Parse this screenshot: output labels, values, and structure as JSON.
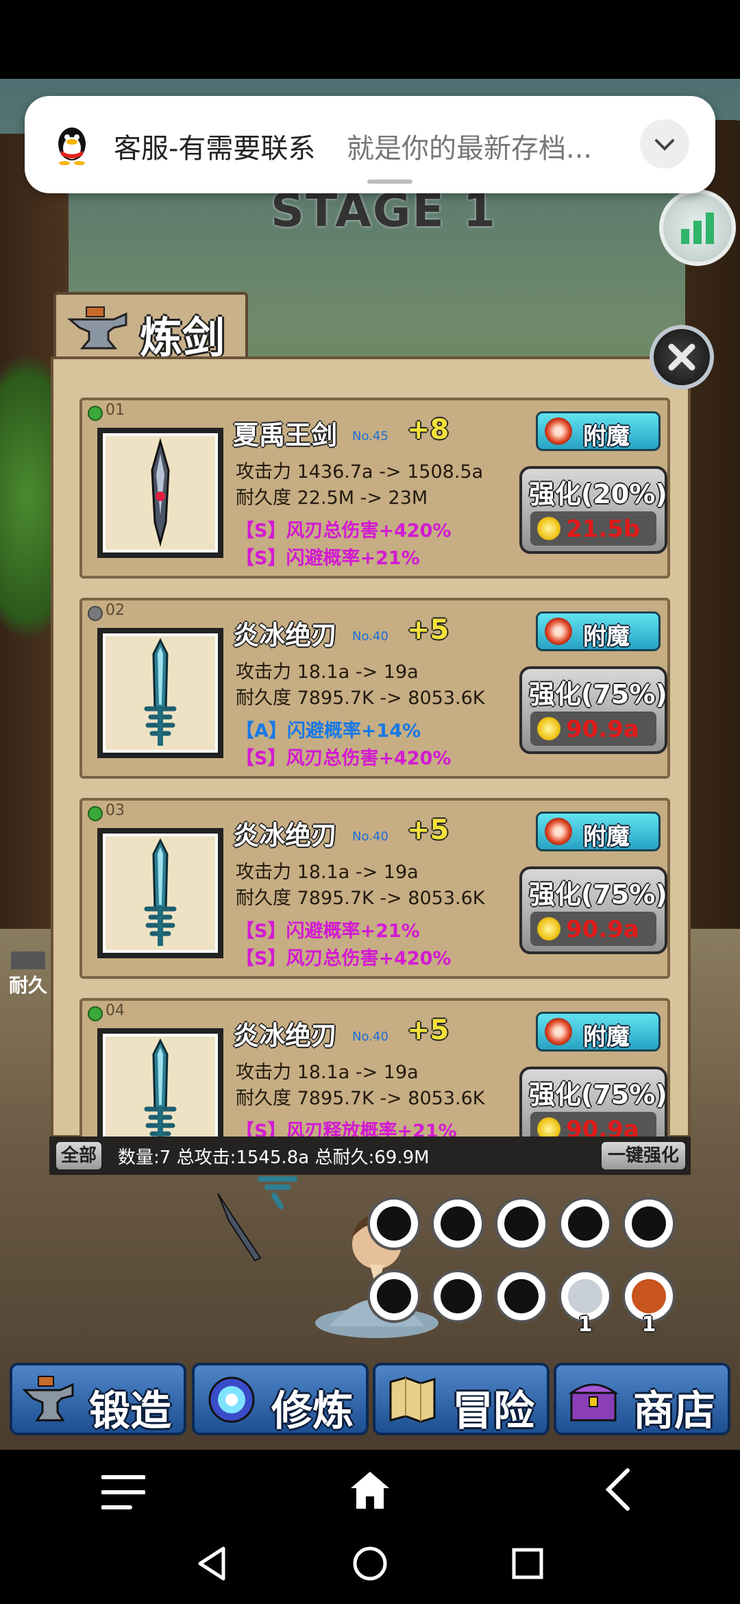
{
  "notification": {
    "title": "客服-有需要联系",
    "text": "就是你的最新存档..."
  },
  "stage_label": "STAGE 1",
  "panel": {
    "title": "炼剑",
    "items": [
      {
        "index": "01",
        "gem": "green",
        "name": "夏禹王剑",
        "number": "No.45",
        "level": "+8",
        "attack": "攻击力 1436.7a -> 1508.5a",
        "durability": "耐久度 22.5M -> 23M",
        "bonus1": "【S】风刃总伤害+420%",
        "bonus2": "【S】闪避概率+21%",
        "enchant_label": "附魔",
        "upgrade_label": "强化(20%)",
        "cost": "21.5b"
      },
      {
        "index": "02",
        "gem": "grey",
        "name": "炎冰绝刃",
        "number": "No.40",
        "level": "+5",
        "attack": "攻击力 18.1a -> 19a",
        "durability": "耐久度 7895.7K -> 8053.6K",
        "bonus1": "【A】闪避概率+14%",
        "bonus2": "【S】风刃总伤害+420%",
        "enchant_label": "附魔",
        "upgrade_label": "强化(75%)",
        "cost": "90.9a"
      },
      {
        "index": "03",
        "gem": "green",
        "name": "炎冰绝刃",
        "number": "No.40",
        "level": "+5",
        "attack": "攻击力 18.1a -> 19a",
        "durability": "耐久度 7895.7K -> 8053.6K",
        "bonus1": "【S】闪避概率+21%",
        "bonus2": "【S】风刃总伤害+420%",
        "enchant_label": "附魔",
        "upgrade_label": "强化(75%)",
        "cost": "90.9a"
      },
      {
        "index": "04",
        "gem": "green",
        "name": "炎冰绝刃",
        "number": "No.40",
        "level": "+5",
        "attack": "攻击力 18.1a -> 19a",
        "durability": "耐久度 7895.7K -> 8053.6K",
        "bonus1": "【S】风刃释放概率+21%",
        "bonus2": "",
        "enchant_label": "附魔",
        "upgrade_label": "强化(75%)",
        "cost": "90.9a"
      }
    ],
    "all_label": "全部",
    "summary": "数量:7 总攻击:1545.8a 总耐久:69.9M",
    "one_key_label": "一键强化"
  },
  "durability_side_label": "耐久",
  "item_slots": [
    {
      "count": ""
    },
    {
      "count": ""
    },
    {
      "count": ""
    },
    {
      "count": ""
    },
    {
      "count": ""
    },
    {
      "count": ""
    },
    {
      "count": ""
    },
    {
      "count": ""
    },
    {
      "count": "1"
    },
    {
      "count": "1"
    }
  ],
  "nav": {
    "forge": "锻造",
    "cultivate": "修炼",
    "adventure": "冒险",
    "shop": "商店"
  },
  "colors": {
    "nav_blue": "#2a5ea8",
    "cost_red": "#e01818",
    "s_bonus": "#d31ad3",
    "a_bonus": "#1878e6"
  }
}
